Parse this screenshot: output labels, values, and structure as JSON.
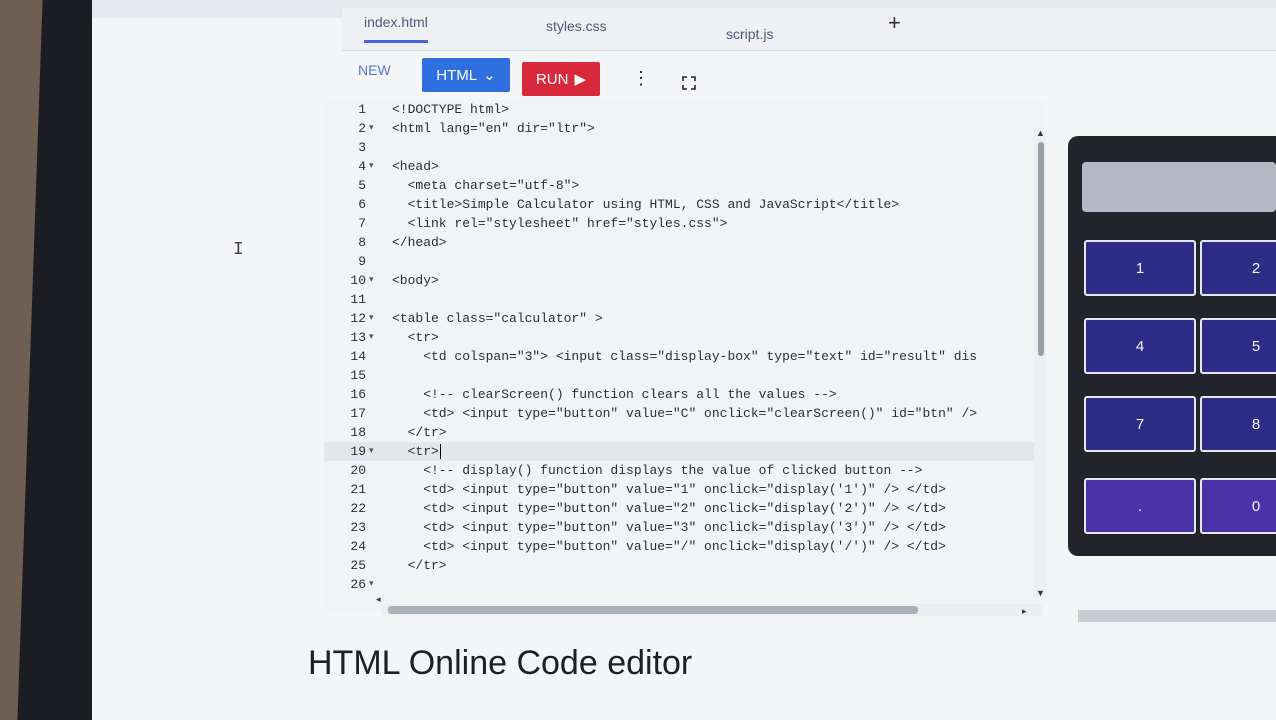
{
  "tabs": [
    "index.html",
    "styles.css",
    "script.js"
  ],
  "add_tab_label": "+",
  "toolbar": {
    "new_label": "NEW",
    "language_label": "HTML",
    "run_label": "RUN",
    "more_icon": "kebab-menu-icon",
    "fullscreen_icon": "fullscreen-icon"
  },
  "editor": {
    "lines": [
      {
        "n": "1",
        "fold": "",
        "text": "<!DOCTYPE html>"
      },
      {
        "n": "2",
        "fold": "▾",
        "text": "<html lang=\"en\" dir=\"ltr\">"
      },
      {
        "n": "3",
        "fold": "",
        "text": ""
      },
      {
        "n": "4",
        "fold": "▾",
        "text": "<head>"
      },
      {
        "n": "5",
        "fold": "",
        "text": "  <meta charset=\"utf-8\">"
      },
      {
        "n": "6",
        "fold": "",
        "text": "  <title>Simple Calculator using HTML, CSS and JavaScript</title>"
      },
      {
        "n": "7",
        "fold": "",
        "text": "  <link rel=\"stylesheet\" href=\"styles.css\">"
      },
      {
        "n": "8",
        "fold": "",
        "text": "</head>"
      },
      {
        "n": "9",
        "fold": "",
        "text": ""
      },
      {
        "n": "10",
        "fold": "▾",
        "text": "<body>"
      },
      {
        "n": "11",
        "fold": "",
        "text": ""
      },
      {
        "n": "12",
        "fold": "▾",
        "text": "<table class=\"calculator\" >"
      },
      {
        "n": "13",
        "fold": "▾",
        "text": "  <tr>"
      },
      {
        "n": "14",
        "fold": "",
        "text": "    <td colspan=\"3\"> <input class=\"display-box\" type=\"text\" id=\"result\" dis"
      },
      {
        "n": "15",
        "fold": "",
        "text": ""
      },
      {
        "n": "16",
        "fold": "",
        "text": "    <!-- clearScreen() function clears all the values -->"
      },
      {
        "n": "17",
        "fold": "",
        "text": "    <td> <input type=\"button\" value=\"C\" onclick=\"clearScreen()\" id=\"btn\" />"
      },
      {
        "n": "18",
        "fold": "",
        "text": "  </tr>"
      },
      {
        "n": "19",
        "fold": "▾",
        "text": "  <tr>"
      },
      {
        "n": "20",
        "fold": "",
        "text": "    <!-- display() function displays the value of clicked button -->"
      },
      {
        "n": "21",
        "fold": "",
        "text": "    <td> <input type=\"button\" value=\"1\" onclick=\"display('1')\" /> </td>"
      },
      {
        "n": "22",
        "fold": "",
        "text": "    <td> <input type=\"button\" value=\"2\" onclick=\"display('2')\" /> </td>"
      },
      {
        "n": "23",
        "fold": "",
        "text": "    <td> <input type=\"button\" value=\"3\" onclick=\"display('3')\" /> </td>"
      },
      {
        "n": "24",
        "fold": "",
        "text": "    <td> <input type=\"button\" value=\"/\" onclick=\"display('/')\" /> </td>"
      },
      {
        "n": "25",
        "fold": "",
        "text": "  </tr>"
      },
      {
        "n": "26",
        "fold": "▾",
        "text": ""
      }
    ],
    "current_line": "19"
  },
  "preview": {
    "keys": [
      "1",
      "2",
      "4",
      "5",
      "7",
      "8",
      ".",
      "0"
    ]
  },
  "heading": "HTML Online Code editor",
  "colors": {
    "html_button": "#2f6fe0",
    "run_button": "#d8283c",
    "calc_key": "#2d2d88",
    "calc_body": "#23232b"
  }
}
